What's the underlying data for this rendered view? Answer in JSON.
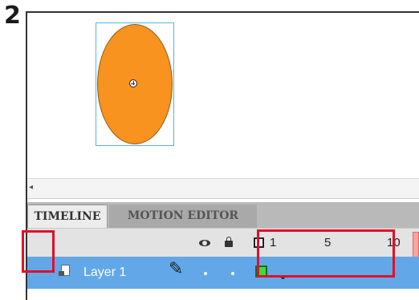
{
  "step_number": "2",
  "stage": {
    "shape": "ellipse",
    "shape_fill": "#f7931e",
    "selection_color": "#4fb3e8",
    "registration_point": "crosshair-circle-icon"
  },
  "tabs": [
    {
      "label": "TIMELINE",
      "active": true
    },
    {
      "label": "MOTION EDITOR",
      "active": false
    }
  ],
  "timeline_header": {
    "icons": [
      "eye-icon",
      "lock-icon",
      "outline-icon"
    ],
    "frame_numbers": [
      "1",
      "5",
      "10"
    ]
  },
  "layer": {
    "name": "Layer 1",
    "selected": true,
    "color": "#62a8e9",
    "outline_color": "#3ddc3d"
  },
  "highlight_color": "#e0102a"
}
